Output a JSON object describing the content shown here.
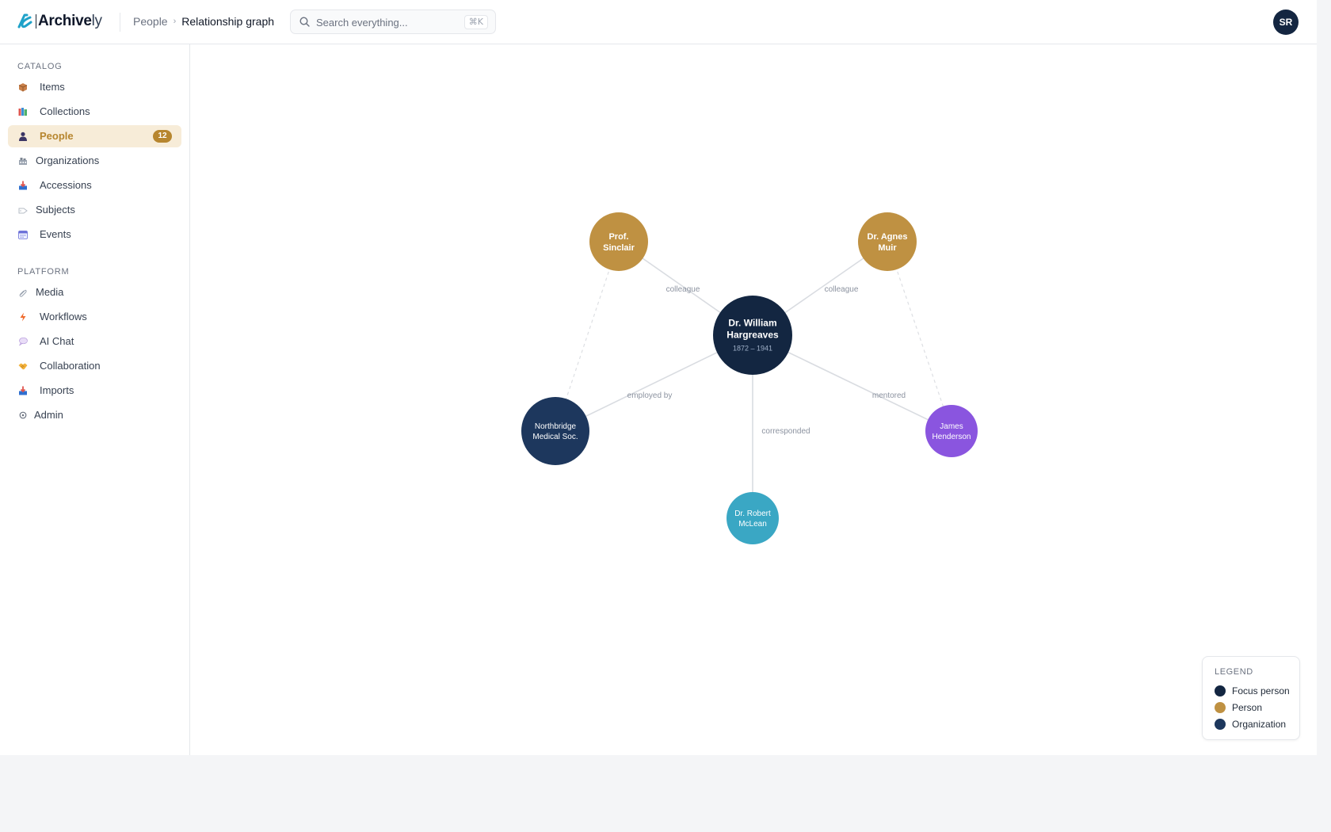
{
  "header": {
    "logo": {
      "prefix": "Archive",
      "suffix": "ly"
    },
    "breadcrumb": {
      "parent": "People",
      "separator": "›",
      "current": "Relationship graph"
    },
    "search": {
      "placeholder": "Search everything...",
      "value": "",
      "shortcut": "⌘K"
    },
    "avatar_initials": "SR"
  },
  "sidebar": {
    "catalog_label": "CATALOG",
    "catalog_items": [
      {
        "label": "Items",
        "icon": "package-icon"
      },
      {
        "label": "Collections",
        "icon": "books-icon"
      },
      {
        "label": "People",
        "icon": "person-icon",
        "active": true,
        "badge": "12"
      },
      {
        "label": "Organizations",
        "icon": "building-icon"
      },
      {
        "label": "Accessions",
        "icon": "inbox-tray-icon"
      },
      {
        "label": "Subjects",
        "icon": "tag-icon"
      },
      {
        "label": "Events",
        "icon": "calendar-icon"
      }
    ],
    "platform_label": "PLATFORM",
    "platform_items": [
      {
        "label": "Media",
        "icon": "paperclip-icon"
      },
      {
        "label": "Workflows",
        "icon": "lightning-icon"
      },
      {
        "label": "AI Chat",
        "icon": "speech-bubble-icon"
      },
      {
        "label": "Collaboration",
        "icon": "handshake-icon"
      },
      {
        "label": "Imports",
        "icon": "inbox-tray-icon"
      },
      {
        "label": "Admin",
        "icon": "gear-icon"
      }
    ]
  },
  "graph": {
    "nodes": [
      {
        "id": "focus",
        "type": "focus",
        "lines": [
          "Dr. William",
          "Hargreaves"
        ],
        "dates": "1872 – 1941"
      },
      {
        "id": "sinclair",
        "type": "person",
        "lines": [
          "Prof.",
          "Sinclair"
        ]
      },
      {
        "id": "muir",
        "type": "person",
        "lines": [
          "Dr. Agnes",
          "Muir"
        ]
      },
      {
        "id": "northbridge",
        "type": "organization",
        "lines": [
          "Northbridge",
          "Medical Soc."
        ]
      },
      {
        "id": "henderson",
        "type": "student",
        "lines": [
          "James",
          "Henderson"
        ]
      },
      {
        "id": "mclean",
        "type": "correspondent",
        "lines": [
          "Dr. Robert",
          "McLean"
        ]
      }
    ],
    "edges": [
      {
        "from": "focus",
        "to": "sinclair",
        "label": "colleague",
        "arrow": true
      },
      {
        "from": "focus",
        "to": "muir",
        "label": "colleague",
        "arrow": true
      },
      {
        "from": "focus",
        "to": "northbridge",
        "label": "employed by",
        "arrow": false
      },
      {
        "from": "focus",
        "to": "henderson",
        "label": "mentored",
        "arrow": false
      },
      {
        "from": "focus",
        "to": "mclean",
        "label": "corresponded",
        "arrow": true
      },
      {
        "from": "sinclair",
        "to": "northbridge",
        "label": "",
        "dashed": true
      },
      {
        "from": "muir",
        "to": "henderson",
        "label": "",
        "dashed": true
      }
    ]
  },
  "legend": {
    "title": "LEGEND",
    "items": [
      {
        "label": "Focus person",
        "color": "#132641"
      },
      {
        "label": "Person",
        "color": "#bf9142"
      },
      {
        "label": "Organization",
        "color": "#1d375d"
      }
    ]
  },
  "colors": {
    "focus": "#132641",
    "person": "#bf9142",
    "organization": "#1d375d",
    "student": "#8a55df",
    "correspondent": "#3aa7c4",
    "active_nav": "#b7862f",
    "edge": "#d9dce1"
  }
}
